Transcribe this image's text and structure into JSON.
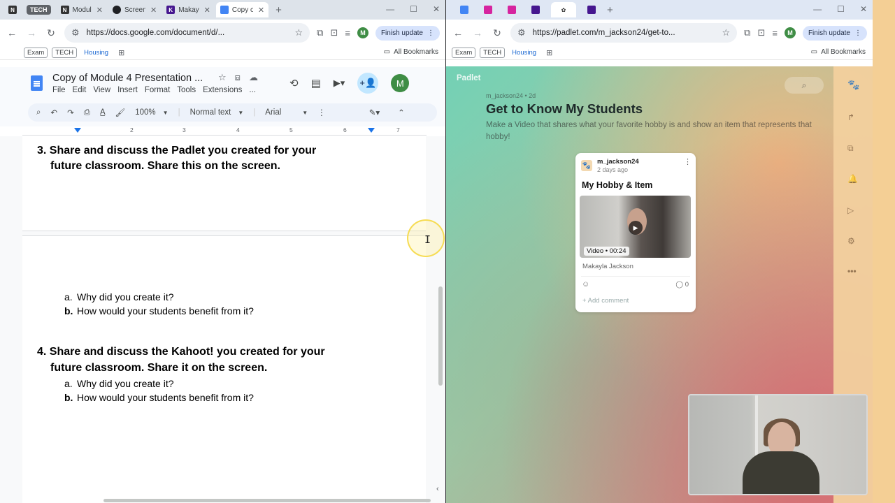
{
  "left_browser": {
    "tabs": [
      {
        "favicon": "N",
        "title": "",
        "active": false
      },
      {
        "favicon": "tech-pill",
        "title": "TECH",
        "active": false
      },
      {
        "favicon": "N",
        "title": "Modul",
        "active": false
      },
      {
        "favicon": "screencast-icon",
        "title": "Screen",
        "active": false
      },
      {
        "favicon": "K",
        "title": "Makay",
        "active": false
      },
      {
        "favicon": "docs-icon",
        "title": "Copy o",
        "active": true
      }
    ],
    "url": "https://docs.google.com/document/d/...",
    "finish_update": "Finish update",
    "avatar_letter": "M",
    "bookmarks": [
      "Exam",
      "TECH",
      "Housing"
    ],
    "all_bookmarks": "All Bookmarks"
  },
  "docs": {
    "title": "Copy of Module 4 Presentation ...",
    "menu": [
      "File",
      "Edit",
      "View",
      "Insert",
      "Format",
      "Tools",
      "Extensions",
      "..."
    ],
    "zoom": "100%",
    "style": "Normal text",
    "font": "Arial",
    "avatar_letter": "M",
    "ruler": [
      "1",
      "2",
      "3",
      "4",
      "5",
      "6",
      "7"
    ],
    "item3_line1": "3.   Share and discuss the Padlet you created for your",
    "item3_line2": "future classroom.  Share this on the screen.",
    "item3_a": "Why did you create it?",
    "item3_b": "How would your students benefit from it?",
    "item4_line1": "4.   Share and discuss the Kahoot! you created for your",
    "item4_line2": "future classroom. Share it on the screen.",
    "item4_a": "Why did you create it?",
    "item4_b": "How would your students benefit from it?",
    "label_a": "a.",
    "label_b": "b."
  },
  "right_browser": {
    "url": "https://padlet.com/m_jackson24/get-to...",
    "finish_update": "Finish update",
    "avatar_letter": "M",
    "bookmarks": [
      "Exam",
      "TECH",
      "Housing"
    ],
    "all_bookmarks": "All Bookmarks"
  },
  "padlet": {
    "logo": "Padlet",
    "meta": "m_jackson24 • 2d",
    "title": "Get to Know My Students",
    "description": "Make a Video that shares what your favorite hobby is and show an item that represents that hobby!",
    "post": {
      "author": "m_jackson24",
      "time": "2 days ago",
      "title": "My Hobby & Item",
      "video_label": "Video • 00:24",
      "caption": "Makayla Jackson",
      "comment_count": "0",
      "add_comment": "Add comment"
    }
  },
  "colors": {
    "docs_blue": "#4285f4",
    "avatar_green": "#3f8d45",
    "padlet_teal": "#73d1b5",
    "padlet_sidebar": "#f2d09e"
  }
}
